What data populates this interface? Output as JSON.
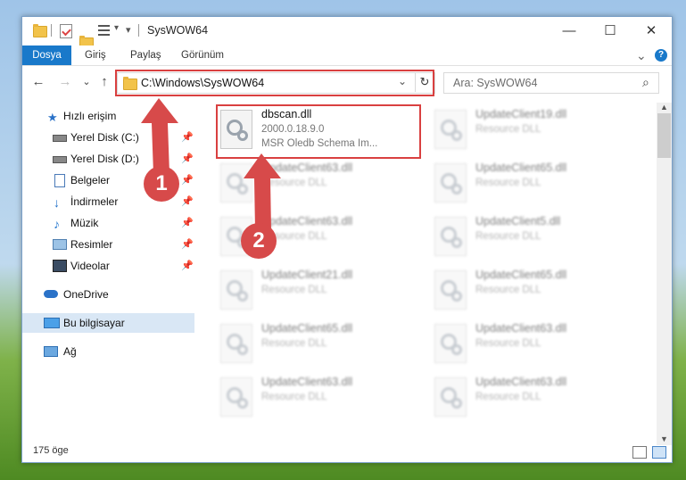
{
  "window": {
    "title": "SysWOW64"
  },
  "controls": {
    "minimize": "—",
    "maximize": "☐",
    "close": "✕"
  },
  "ribbon": {
    "tabs": [
      "Dosya",
      "Giriş",
      "Paylaş",
      "Görünüm"
    ],
    "expand": "⌄",
    "help": "?"
  },
  "nav": {
    "back": "←",
    "forward": "→",
    "recent": "⌄",
    "up": "↑"
  },
  "address": {
    "path": "C:\\Windows\\SysWOW64",
    "dropdown": "⌄",
    "refresh": "↻"
  },
  "search": {
    "placeholder": "Ara: SysWOW64",
    "icon": "⌕"
  },
  "sidebar": {
    "items": [
      {
        "label": "Hızlı erişim",
        "icon": "star-icon"
      },
      {
        "label": "Yerel Disk (C:)",
        "icon": "drive-icon",
        "pinned": true
      },
      {
        "label": "Yerel Disk (D:)",
        "icon": "drive-icon",
        "pinned": true
      },
      {
        "label": "Belgeler",
        "icon": "documents-icon",
        "pinned": true
      },
      {
        "label": "İndirmeler",
        "icon": "download-icon",
        "pinned": true
      },
      {
        "label": "Müzik",
        "icon": "music-icon",
        "pinned": true
      },
      {
        "label": "Resimler",
        "icon": "pictures-icon",
        "pinned": true
      },
      {
        "label": "Videolar",
        "icon": "videos-icon",
        "pinned": true
      },
      {
        "label": "OneDrive",
        "icon": "cloud-icon"
      },
      {
        "label": "Bu bilgisayar",
        "icon": "computer-icon",
        "selected": true
      },
      {
        "label": "Ağ",
        "icon": "network-icon"
      }
    ],
    "pin_glyph": "📌"
  },
  "files": {
    "highlighted": {
      "name": "dbscan.dll",
      "version": "2000.0.18.9.0",
      "description": "MSR Oledb Schema Im..."
    },
    "others": [
      {
        "name": "UpdateClient19.dll",
        "type": "Resource DLL"
      },
      {
        "name": "UpdateClient63.dll",
        "type": "Resource DLL"
      },
      {
        "name": "UpdateClient65.dll",
        "type": "Resource DLL"
      },
      {
        "name": "UpdateClient63.dll",
        "type": "Resource DLL"
      },
      {
        "name": "UpdateClient5.dll",
        "type": "Resource DLL"
      },
      {
        "name": "UpdateClient21.dll",
        "type": "Resource DLL"
      },
      {
        "name": "UpdateClient65.dll",
        "type": "Resource DLL"
      },
      {
        "name": "UpdateClient65.dll",
        "type": "Resource DLL"
      },
      {
        "name": "UpdateClient63.dll",
        "type": "Resource DLL"
      },
      {
        "name": "UpdateClient63.dll",
        "type": "Resource DLL"
      },
      {
        "name": "UpdateClient63.dll",
        "type": "Resource DLL"
      }
    ]
  },
  "status": {
    "count": "175 öge"
  },
  "annotations": {
    "one": "1",
    "two": "2"
  },
  "colors": {
    "accent": "#1979ca",
    "highlight": "#d94040",
    "selection": "#d9e7f5"
  }
}
